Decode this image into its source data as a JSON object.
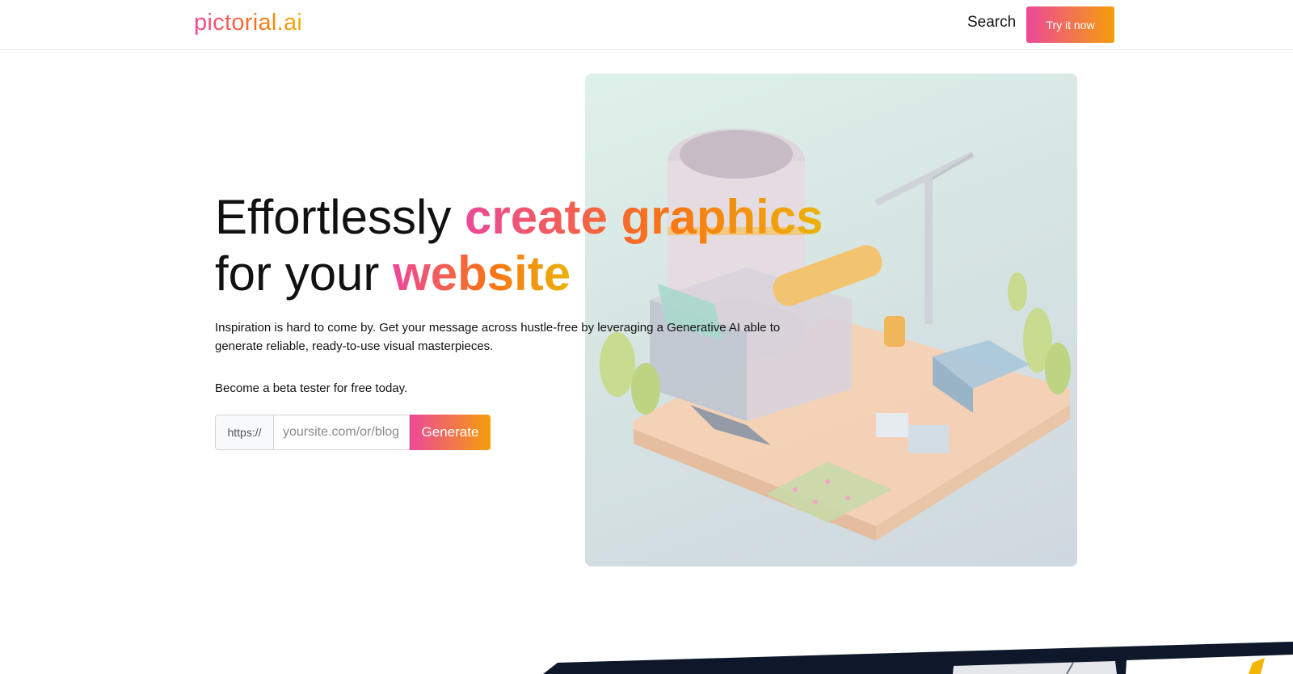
{
  "header": {
    "logo": "pictorial.ai",
    "search_label": "Search",
    "cta_label": "Try it now"
  },
  "hero": {
    "headline_part1": "Effortlessly ",
    "headline_highlight1": "create graphics",
    "headline_part2": "for your ",
    "headline_highlight2": "website",
    "lead": "Inspiration is hard to come by. Get your message across hustle-free by leveraging a Generative AI able to generate reliable, ready-to-use visual masterpieces.",
    "beta": "Become a beta tester for free today.",
    "form": {
      "prefix": "https://",
      "placeholder": "yoursite.com/or/blog",
      "value": "",
      "button_label": "Generate"
    },
    "image_subject": "isometric-construction-scene"
  },
  "colors": {
    "gradient_start": "#ec4899",
    "gradient_mid": "#f97316",
    "gradient_end": "#eab308",
    "showcase_dark": "#0f172a"
  }
}
